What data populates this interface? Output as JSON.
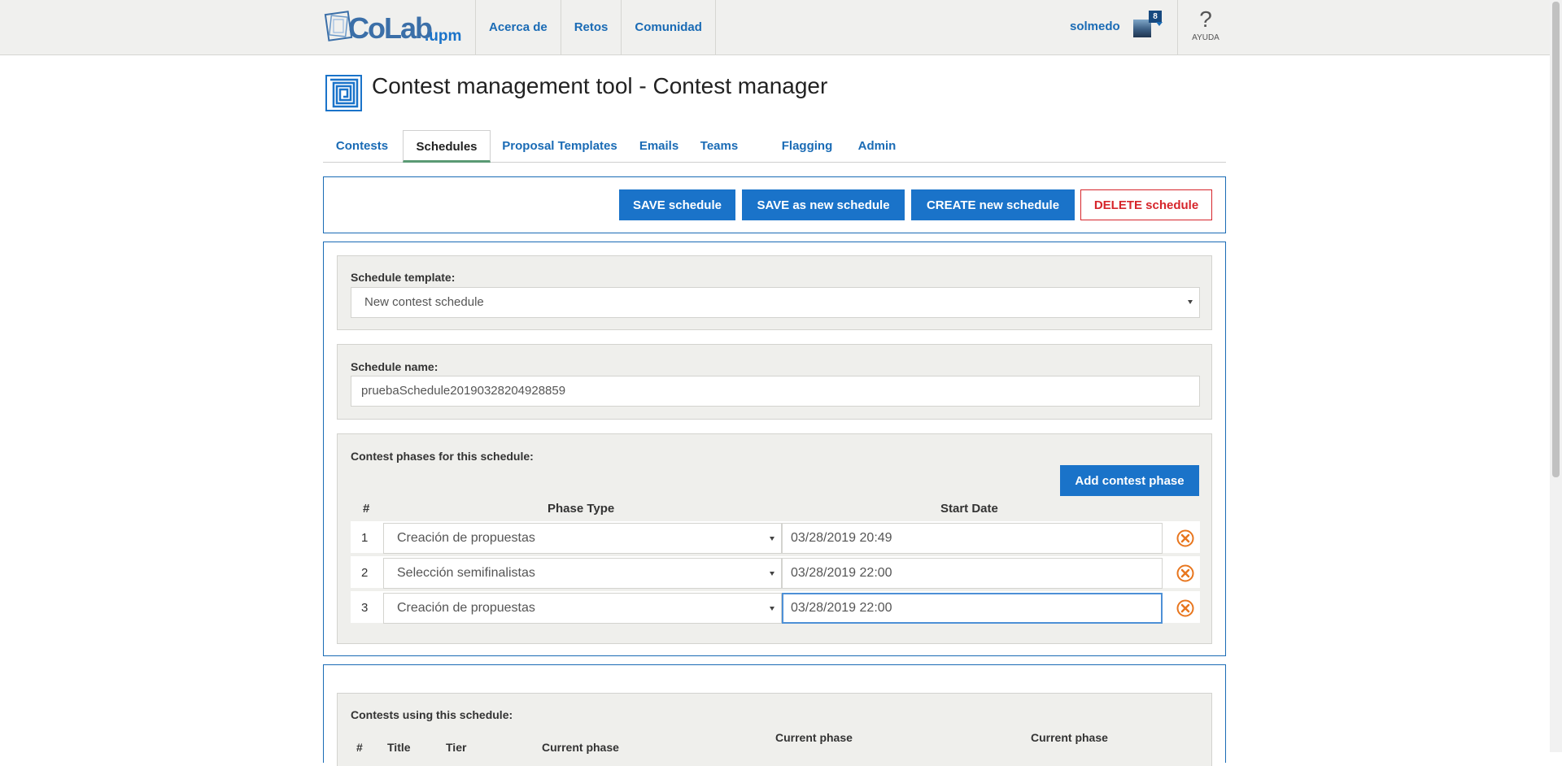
{
  "header": {
    "logo_text": "CoLab",
    "logo_sub": ".upm",
    "nav": [
      "Acerca de",
      "Retos",
      "Comunidad"
    ],
    "user_name": "solmedo",
    "notifications": "8",
    "help_label": "AYUDA",
    "help_glyph": "?"
  },
  "page": {
    "title": "Contest management tool - Contest manager",
    "icon": "maze-icon"
  },
  "tabs": [
    "Contests",
    "Schedules",
    "Proposal Templates",
    "Emails",
    "Teams",
    "Flagging",
    "Admin"
  ],
  "active_tab": "Schedules",
  "actions": {
    "save": "SAVE schedule",
    "save_new": "SAVE as new schedule",
    "create": "CREATE new schedule",
    "delete": "DELETE schedule"
  },
  "template": {
    "label": "Schedule template:",
    "value": "New contest schedule"
  },
  "schedule_name": {
    "label": "Schedule name:",
    "value": "pruebaSchedule20190328204928859"
  },
  "phases": {
    "label": "Contest phases for this schedule:",
    "add_button": "Add contest phase",
    "columns": [
      "#",
      "Phase Type",
      "Start Date"
    ],
    "rows": [
      {
        "num": "1",
        "type": "Creación de propuestas",
        "date": "03/28/2019 20:49"
      },
      {
        "num": "2",
        "type": "Selección semifinalistas",
        "date": "03/28/2019 22:00"
      },
      {
        "num": "3",
        "type": "Creación de propuestas",
        "date": "03/28/2019 22:00"
      }
    ]
  },
  "contests": {
    "label": "Contests using this schedule:",
    "columns": [
      "#",
      "Title",
      "Tier",
      "Current phase",
      "Current phase",
      "Current phase"
    ]
  },
  "colors": {
    "primary": "#1a73c9",
    "danger": "#d6252b",
    "remove": "#e8761e"
  }
}
